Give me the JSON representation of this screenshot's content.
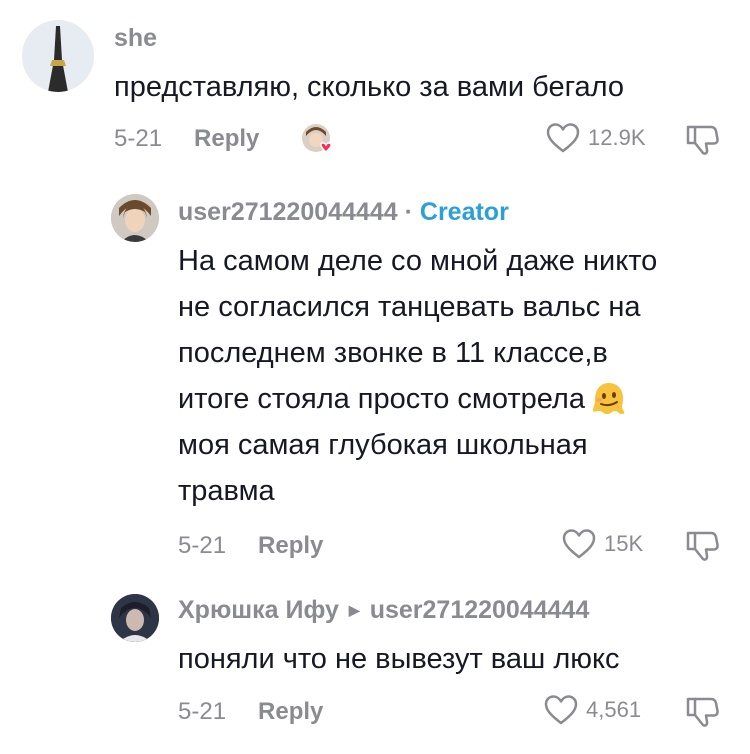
{
  "comments": [
    {
      "username": "she",
      "text": "представляю, сколько за вами бегало",
      "date": "5-21",
      "reply_label": "Reply",
      "likes": "12.9K",
      "liked_by_creator": true
    },
    {
      "username": "user271220044444",
      "separator": "·",
      "badge": "Creator",
      "text_lines": [
        "На самом деле со мной даже никто",
        "не согласился танцевать вальс на",
        "последнем звонке в 11 классе,в",
        "итоге стояла просто смотрела",
        "моя самая глубокая школьная",
        "травма"
      ],
      "emoji": "melting-face-icon",
      "date": "5-21",
      "reply_label": "Reply",
      "likes": "15K"
    },
    {
      "username": "Хрюшка Ифу",
      "reply_to": "user271220044444",
      "text": "поняли что не вывезут ваш люкс",
      "date": "5-21",
      "reply_label": "Reply",
      "likes": "4,561"
    }
  ],
  "colors": {
    "text": "#161823",
    "muted": "#8a8b91",
    "creator": "#2a9fd8",
    "heart": "#fe2c55"
  }
}
